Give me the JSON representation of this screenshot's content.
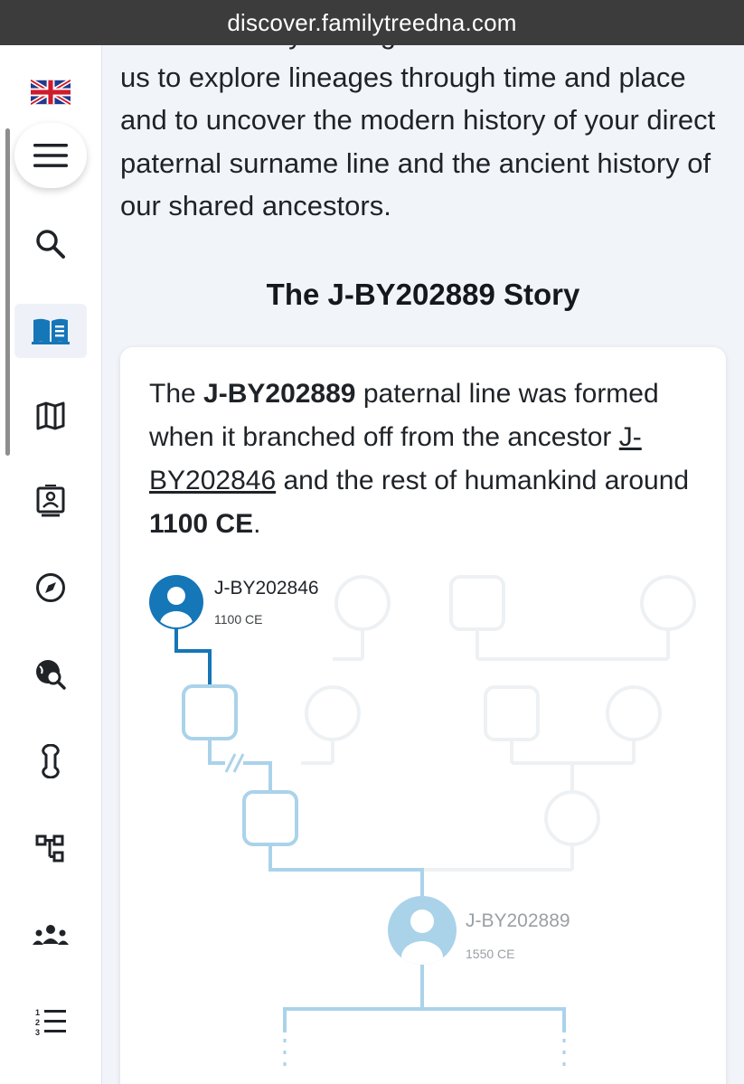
{
  "browser": {
    "url": "discover.familytreedna.com"
  },
  "sidebar": {
    "items": [
      {
        "name": "language-flag",
        "icon": "uk-flag-icon"
      },
      {
        "name": "menu",
        "icon": "hamburger-menu-icon"
      },
      {
        "name": "search",
        "icon": "search-icon"
      },
      {
        "name": "story",
        "icon": "book-icon",
        "active": true
      },
      {
        "name": "map",
        "icon": "map-icon"
      },
      {
        "name": "profile",
        "icon": "id-card-icon"
      },
      {
        "name": "compass",
        "icon": "compass-icon"
      },
      {
        "name": "globe-search",
        "icon": "globe-search-icon"
      },
      {
        "name": "bone",
        "icon": "bone-icon"
      },
      {
        "name": "tree",
        "icon": "tree-diagram-icon"
      },
      {
        "name": "groups",
        "icon": "people-group-icon"
      },
      {
        "name": "list",
        "icon": "numbered-list-icon"
      }
    ]
  },
  "intro": {
    "text": "thousands of years ago. This human tree allows us to explore lineages through time and place and to uncover the modern history of your direct paternal surname line and the ancient history of our shared ancestors."
  },
  "story": {
    "title": "The J-BY202889 Story",
    "sentence": {
      "p1": "The ",
      "haplogroup": "J-BY202889",
      "p2": " paternal line was formed when it branched off from the ancestor ",
      "ancestor_link": "J-BY202846",
      "p3": " and the rest of humankind around ",
      "date": "1100 CE",
      "p4": "."
    }
  },
  "tree": {
    "ancestor": {
      "name": "J-BY202846",
      "date": "1100 CE"
    },
    "descendant": {
      "name": "J-BY202889",
      "date": "1550 CE"
    },
    "colors": {
      "primary": "#1576b8",
      "light": "#aad3ea",
      "faint": "#eef1f4",
      "muted_text": "#9aa0a6"
    }
  }
}
